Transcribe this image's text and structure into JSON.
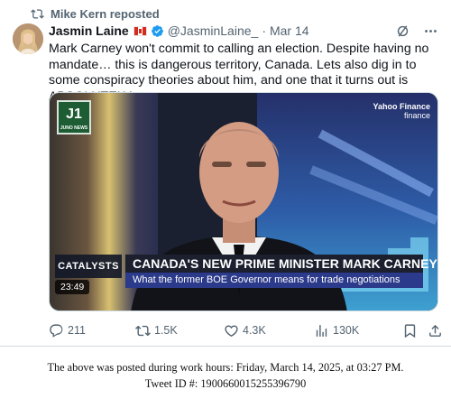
{
  "repost": {
    "text": "Mike Kern reposted",
    "icon": "repost-icon"
  },
  "author": {
    "name": "Jasmin Laine",
    "flag": "canada-flag-icon",
    "verified": "verified-badge-icon",
    "handle": "@JasminLaine_",
    "separator": "·",
    "time": "Mar 14"
  },
  "tweet": {
    "text": "Mark Carney won't commit to calling an election. Despite having no mandate… this is dangerous territory, Canada. Lets also dig in to some conspiracy theories about him, and one that it turns out is ABSOLUTELY true."
  },
  "media": {
    "channel_logo": "J1",
    "channel_sub": "JUNO NEWS",
    "partner_logo": "Yahoo Finance",
    "partner_sub": "finance",
    "segment": "CATALYSTS",
    "duration": "23:49",
    "headline": "CANADA'S NEW PRIME MINISTER MARK CARNEY",
    "subheadline": "What the former BOE Governor means for trade negotiations"
  },
  "actions": {
    "replies": "211",
    "reposts": "1.5K",
    "likes": "4.3K",
    "views": "130K"
  },
  "footer": {
    "line1": "The above was posted during work hours: Friday, March 14, 2025, at 03:27 PM.",
    "line2": "Tweet ID #: 1900660015255396790"
  },
  "colors": {
    "accent": "#1d9bf0",
    "muted": "#536471",
    "text": "#0f1419"
  }
}
